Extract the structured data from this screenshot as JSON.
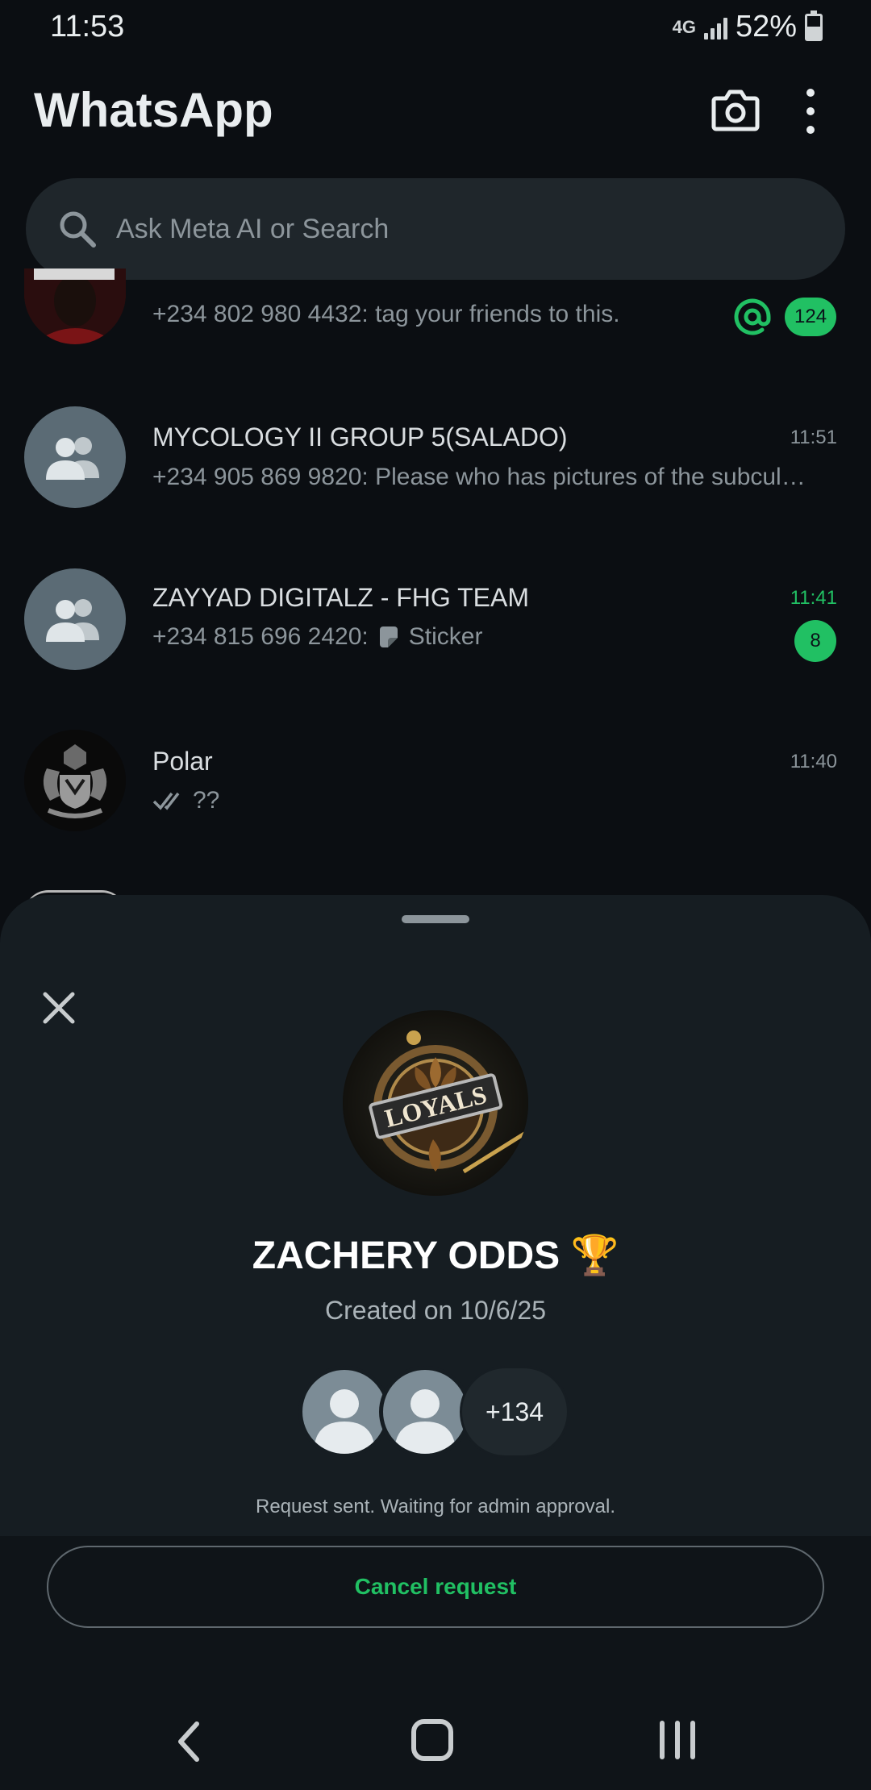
{
  "status_bar": {
    "time": "11:53",
    "network": "4G",
    "battery": "52%"
  },
  "header": {
    "title": "WhatsApp",
    "icons": [
      "camera-icon",
      "more-options-icon"
    ]
  },
  "search": {
    "placeholder": "Ask Meta AI or Search"
  },
  "chats": [
    {
      "name": "",
      "message": "+234 802 980 4432: tag your friends to this.",
      "time": "",
      "mention": true,
      "unread": "124"
    },
    {
      "name": "MYCOLOGY II GROUP 5(SALADO)",
      "message": "+234 905 869 9820: Please who has pictures of the subcul…",
      "time": "11:51",
      "unread": ""
    },
    {
      "name": "ZAYYAD DIGITALZ - FHG TEAM",
      "message_sender": "+234 815 696 2420:",
      "message": "Sticker",
      "time": "11:41",
      "unread": "8"
    },
    {
      "name": "Polar",
      "message": "??",
      "time": "11:40",
      "read_receipt": "double-check-icon"
    }
  ],
  "sheet": {
    "group_name": "ZACHERY ODDS 🏆",
    "group_logo_text": "LOYALS",
    "created": "Created on 10/6/25",
    "member_extra": "+134",
    "status": "Request sent. Waiting for admin approval.",
    "cancel_label": "Cancel request"
  },
  "nav": {
    "icons": [
      "back-icon",
      "home-icon",
      "recents-icon"
    ]
  },
  "colors": {
    "background": "#0b0e12",
    "accent": "#21c063",
    "sheet": "#161d22"
  }
}
